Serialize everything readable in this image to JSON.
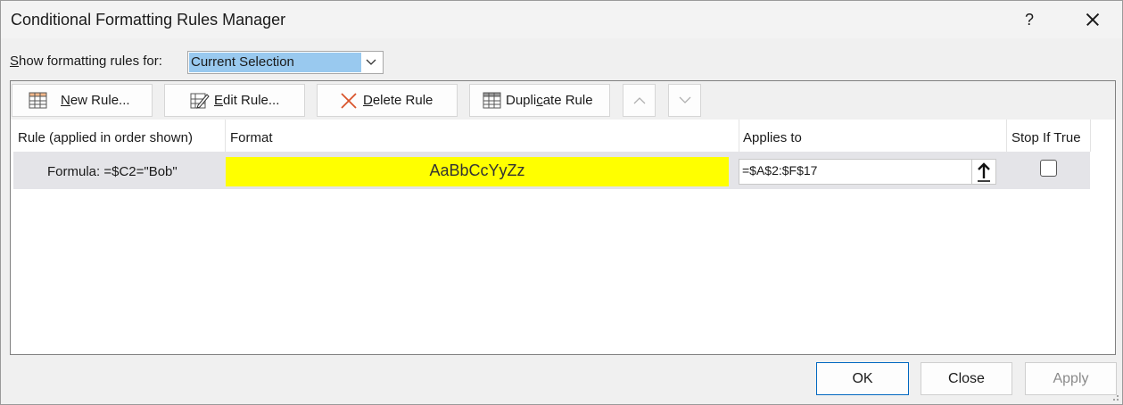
{
  "window": {
    "title": "Conditional Formatting Rules Manager",
    "help_label": "?"
  },
  "show_rules": {
    "label_prefix": "",
    "label_underlined": "S",
    "label_rest": "how formatting rules for:",
    "selected": "Current Selection"
  },
  "toolbar": {
    "new_rule": {
      "ul": "N",
      "rest": "ew Rule..."
    },
    "edit_rule": {
      "ul": "E",
      "rest": "dit Rule..."
    },
    "delete_rule": {
      "ul": "D",
      "rest": "elete Rule"
    },
    "duplicate_rule": {
      "pre": "Dupli",
      "ul": "c",
      "rest": "ate Rule"
    }
  },
  "table": {
    "columns": [
      "Rule (applied in order shown)",
      "Format",
      "Applies to",
      "Stop If True"
    ],
    "rows": [
      {
        "rule": "Formula: =$C2=\"Bob\"",
        "format_preview": "AaBbCcYyZz",
        "applies_to": "=$A$2:$F$17",
        "stop_if_true": false
      }
    ]
  },
  "buttons": {
    "ok": "OK",
    "close": "Close",
    "apply": "Apply"
  },
  "colors": {
    "format_fill": "#ffff00",
    "selection_highlight": "#99c9ef",
    "row_selected": "#e4e4e8"
  }
}
